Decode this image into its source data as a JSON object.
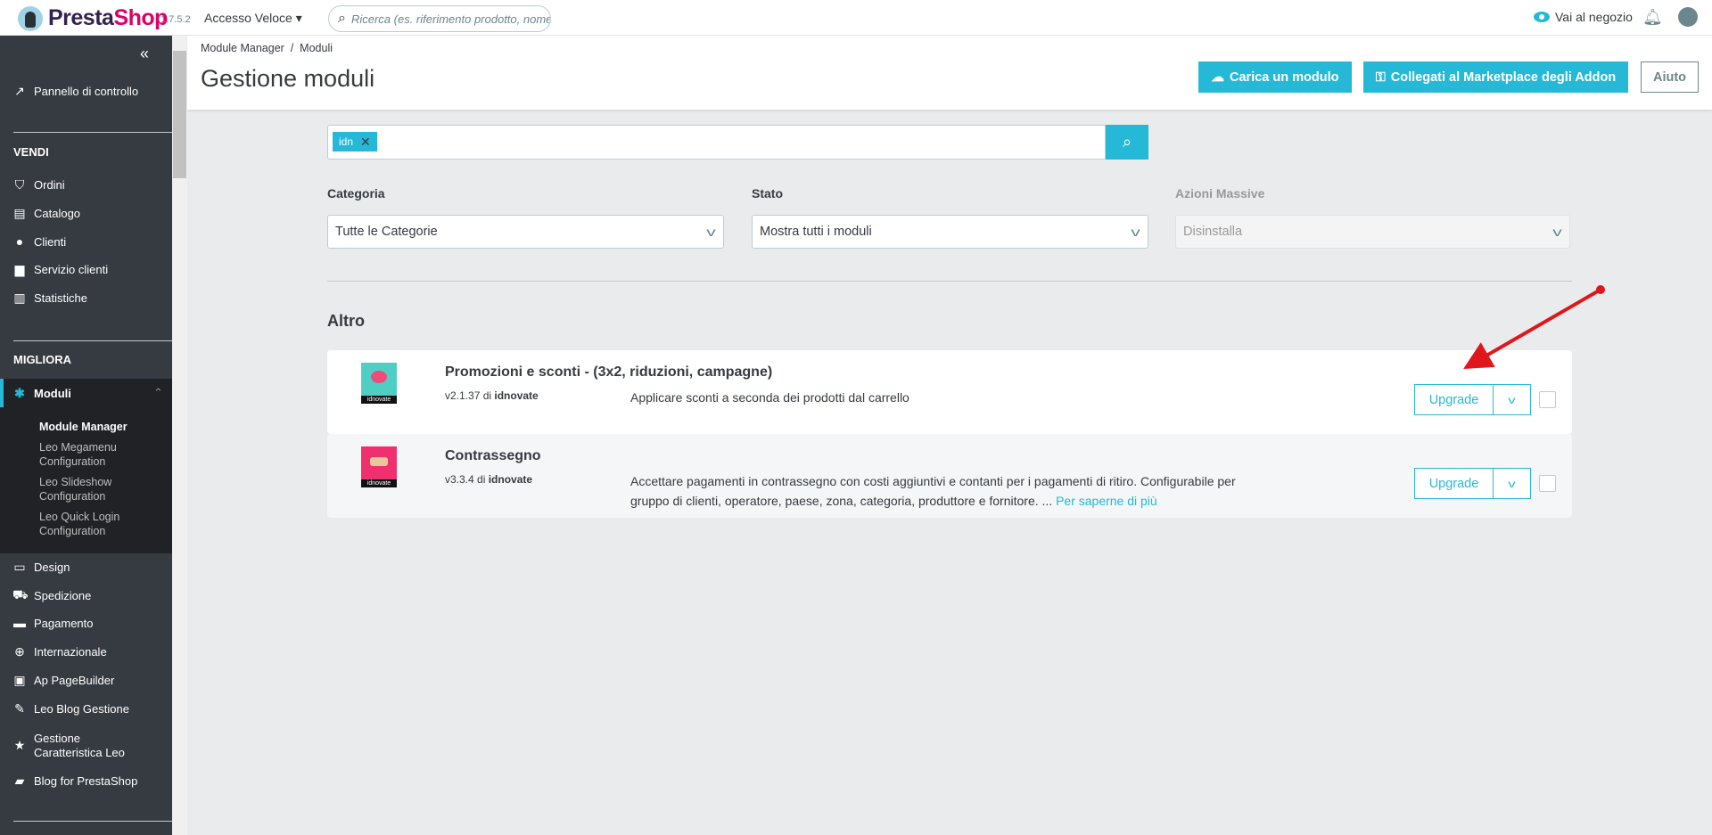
{
  "topbar": {
    "brand_a": "Presta",
    "brand_b": "Shop",
    "version": "1.7.5.2",
    "quick_access": "Accesso Veloce ▾",
    "search_placeholder": "Ricerca (es. riferimento prodotto, nome",
    "shop_link": "Vai al negozio"
  },
  "sidebar": {
    "collapse": "«",
    "dashboard": "Pannello di controllo",
    "section_sell": "VENDI",
    "sell_items": [
      "Ordini",
      "Catalogo",
      "Clienti",
      "Servizio clienti",
      "Statistiche"
    ],
    "section_improve": "MIGLIORA",
    "modules": "Moduli",
    "sub_items": [
      "Module Manager",
      "Leo Megamenu Configuration",
      "Leo Slideshow Configuration",
      "Leo Quick Login Configuration"
    ],
    "improve_items": [
      "Design",
      "Spedizione",
      "Pagamento",
      "Internazionale",
      "Ap PageBuilder",
      "Leo Blog Gestione",
      "Gestione Caratteristica Leo",
      "Blog for PrestaShop"
    ]
  },
  "header": {
    "breadcrumb": "Module Manager  /  Moduli",
    "title": "Gestione moduli",
    "upload_btn": "Carica un modulo",
    "marketplace_btn": "Collegati al Marketplace degli Addon",
    "help_btn": "Aiuto"
  },
  "search": {
    "tag": "idn",
    "tag_remove": "✕"
  },
  "filters": [
    {
      "label": "Categoria",
      "value": "Tutte le Categorie"
    },
    {
      "label": "Stato",
      "value": "Mostra tutti i moduli"
    },
    {
      "label": "Azioni Massive",
      "value": "Disinstalla",
      "disabled": true
    }
  ],
  "section": "Altro",
  "modules": [
    {
      "name": "Promozioni e sconti - (3x2, riduzioni, campagne)",
      "version": "v2.1.37 di ",
      "author": "idnovate",
      "description": "Applicare sconti a seconda dei prodotti dal carrello",
      "more": "",
      "action": "Upgrade",
      "logo_color": "#4fcfc4"
    },
    {
      "name": "Contrassegno",
      "version": "v3.3.4 di ",
      "author": "idnovate",
      "description": "Accettare pagamenti in contrassegno con costi aggiuntivi e contanti per i pagamenti di ritiro. Configurabile per gruppo di clienti, operatore, paese, zona, categoria, produttore e fornitore. ... ",
      "more": "Per saperne di più",
      "action": "Upgrade",
      "logo_color": "#f0306e"
    }
  ],
  "logo_footer": "idnovate",
  "colors": {
    "accent": "#25b9d7",
    "sidebar": "#363a41",
    "arrow": "#e0161b"
  }
}
